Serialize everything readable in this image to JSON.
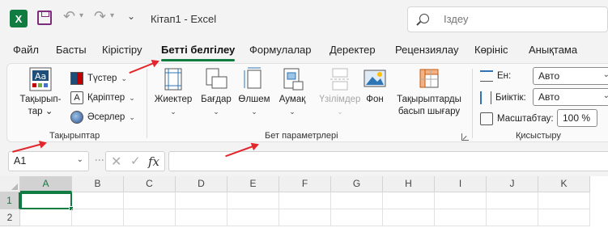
{
  "window": {
    "title": "Кітап1  -  Excel"
  },
  "search": {
    "placeholder": "Іздеу"
  },
  "tabs": [
    {
      "label": "Файл"
    },
    {
      "label": "Басты"
    },
    {
      "label": "Кірістіру"
    },
    {
      "label": "Бетті белгілеу",
      "active": true
    },
    {
      "label": "Формулалар"
    },
    {
      "label": "Деректер"
    },
    {
      "label": "Рецензиялау"
    },
    {
      "label": "Көрініс"
    },
    {
      "label": "Анықтама"
    }
  ],
  "ribbon": {
    "themes": {
      "group_label": "Тақырыптар",
      "themes_btn": "Тақырып-\nтар",
      "colors_btn": "Түстер",
      "fonts_btn": "Қаріптер",
      "effects_btn": "Әсерлер"
    },
    "page_setup": {
      "group_label": "Бет параметрлері",
      "margins": "Жиектер",
      "orientation": "Бағдар",
      "size": "Өлшем",
      "print_area": "Аумақ",
      "breaks": "Үзілімдер",
      "background": "Фон",
      "print_titles": "Тақырыптарды\nбасып шығару"
    },
    "scale_to_fit": {
      "group_label": "Қисыстыру",
      "width_label": "Ен:",
      "width_value": "Авто",
      "height_label": "Биіктік:",
      "height_value": "Авто",
      "scale_label": "Масштабтау:",
      "scale_value": "100 %"
    }
  },
  "formula_bar": {
    "name_box": "A1",
    "fx": "fx",
    "formula": ""
  },
  "grid": {
    "columns": [
      "A",
      "B",
      "C",
      "D",
      "E",
      "F",
      "G",
      "H",
      "I",
      "J",
      "K"
    ],
    "rows": [
      "1",
      "2"
    ],
    "active_cell": "A1"
  },
  "colors": {
    "accent": "#107c41",
    "arrow": "#e3262b"
  }
}
